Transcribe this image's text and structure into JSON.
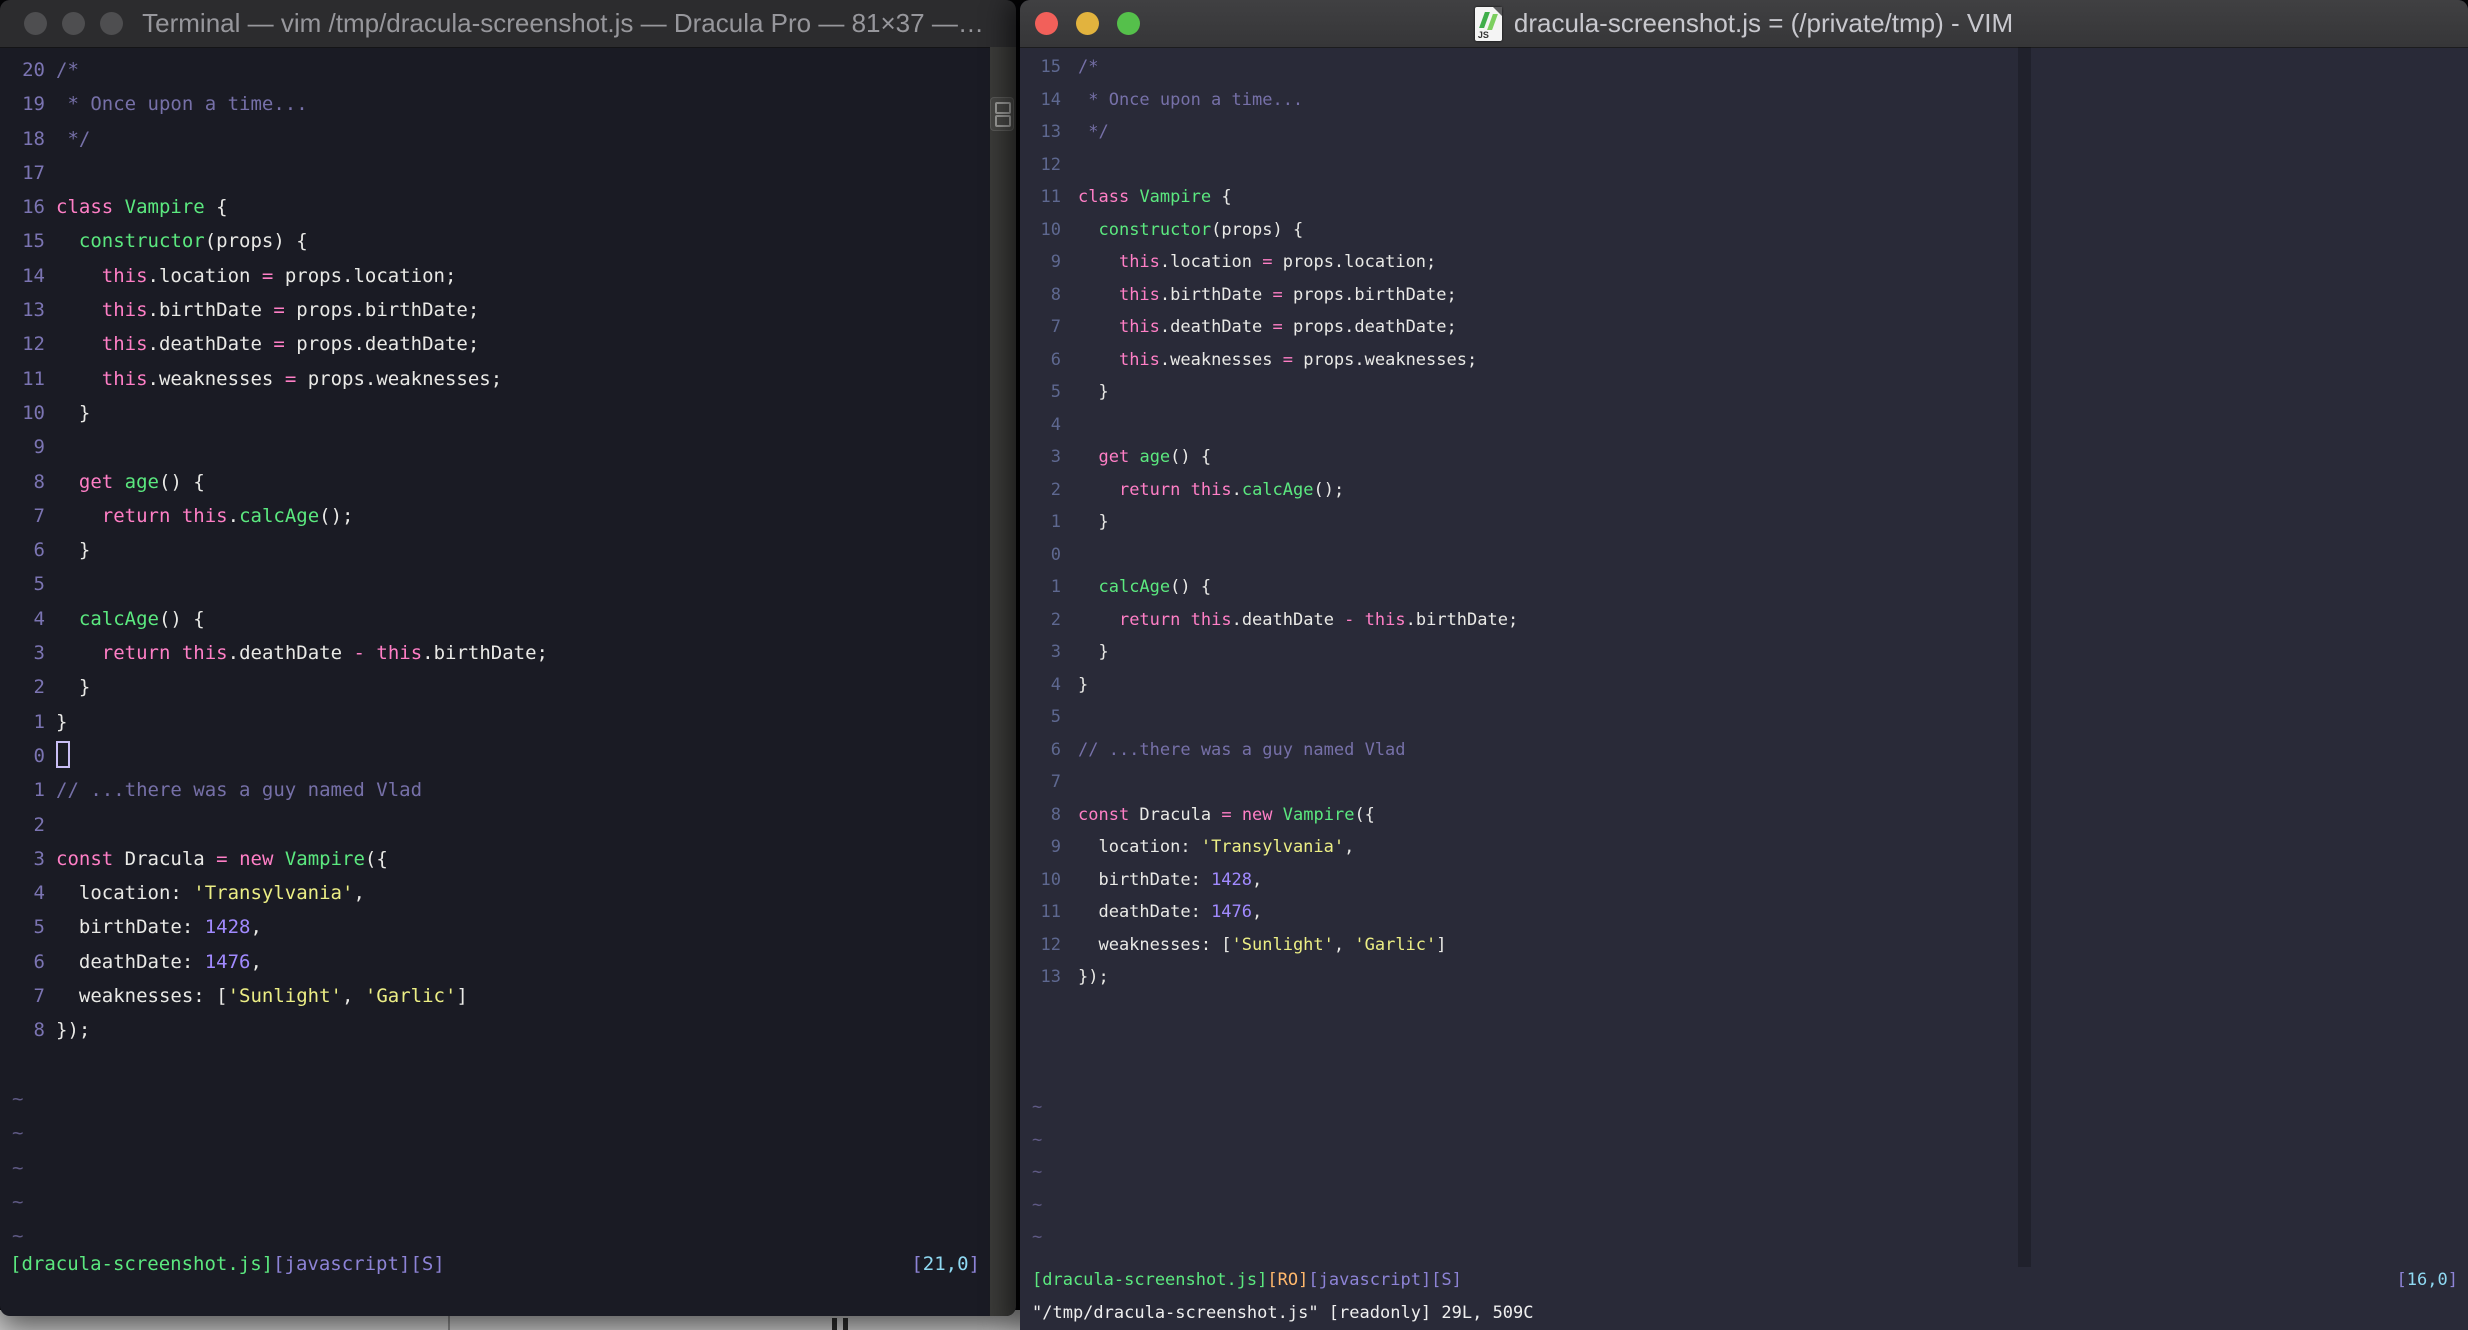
{
  "palette": {
    "cm": "#7670A8",
    "pk": "#FF7FC6",
    "gr": "#5BE87F",
    "fg": "#E9E9E6",
    "pu": "#A18AFF",
    "ye": "#ECEE85",
    "st": "#8D83D6",
    "cy": "#8FD9F2",
    "or": "#FFB86C",
    "fg2": "#EFEFEF",
    "lnL": "#7B74B2",
    "lnR": "#5E6890",
    "td": "#5F5A85",
    "left_bg": "#1A1B24",
    "right_bg": "#292A38"
  },
  "chrome": {
    "tilde": "~",
    "js_icon_label": "JS"
  },
  "buffer": {
    "lines": [
      [
        [
          "cm",
          "/*"
        ]
      ],
      [
        [
          "cm",
          " * Once upon a time..."
        ]
      ],
      [
        [
          "cm",
          " */"
        ]
      ],
      [],
      [
        [
          "pk",
          "class"
        ],
        [
          "fg",
          " "
        ],
        [
          "gr",
          "Vampire"
        ],
        [
          "fg",
          " {"
        ]
      ],
      [
        [
          "fg",
          "  "
        ],
        [
          "gr",
          "constructor"
        ],
        [
          "fg",
          "(props) {"
        ]
      ],
      [
        [
          "fg",
          "    "
        ],
        [
          "pk",
          "this"
        ],
        [
          "fg",
          ".location "
        ],
        [
          "pk",
          "="
        ],
        [
          "fg",
          " props.location;"
        ]
      ],
      [
        [
          "fg",
          "    "
        ],
        [
          "pk",
          "this"
        ],
        [
          "fg",
          ".birthDate "
        ],
        [
          "pk",
          "="
        ],
        [
          "fg",
          " props.birthDate;"
        ]
      ],
      [
        [
          "fg",
          "    "
        ],
        [
          "pk",
          "this"
        ],
        [
          "fg",
          ".deathDate "
        ],
        [
          "pk",
          "="
        ],
        [
          "fg",
          " props.deathDate;"
        ]
      ],
      [
        [
          "fg",
          "    "
        ],
        [
          "pk",
          "this"
        ],
        [
          "fg",
          ".weaknesses "
        ],
        [
          "pk",
          "="
        ],
        [
          "fg",
          " props.weaknesses;"
        ]
      ],
      [
        [
          "fg",
          "  }"
        ]
      ],
      [],
      [
        [
          "fg",
          "  "
        ],
        [
          "pk",
          "get"
        ],
        [
          "fg",
          " "
        ],
        [
          "gr",
          "age"
        ],
        [
          "fg",
          "() {"
        ]
      ],
      [
        [
          "fg",
          "    "
        ],
        [
          "pk",
          "return"
        ],
        [
          "fg",
          " "
        ],
        [
          "pk",
          "this"
        ],
        [
          "fg",
          "."
        ],
        [
          "gr",
          "calcAge"
        ],
        [
          "fg",
          "();"
        ]
      ],
      [
        [
          "fg",
          "  }"
        ]
      ],
      [],
      [
        [
          "fg",
          "  "
        ],
        [
          "gr",
          "calcAge"
        ],
        [
          "fg",
          "() {"
        ]
      ],
      [
        [
          "fg",
          "    "
        ],
        [
          "pk",
          "return"
        ],
        [
          "fg",
          " "
        ],
        [
          "pk",
          "this"
        ],
        [
          "fg",
          ".deathDate "
        ],
        [
          "pk",
          "-"
        ],
        [
          "fg",
          " "
        ],
        [
          "pk",
          "this"
        ],
        [
          "fg",
          ".birthDate;"
        ]
      ],
      [
        [
          "fg",
          "  }"
        ]
      ],
      [
        [
          "fg",
          "}"
        ]
      ],
      [],
      [
        [
          "cm",
          "// ...there was a guy named Vlad"
        ]
      ],
      [],
      [
        [
          "pk",
          "const"
        ],
        [
          "fg",
          " Dracula "
        ],
        [
          "pk",
          "="
        ],
        [
          "fg",
          " "
        ],
        [
          "pk",
          "new"
        ],
        [
          "fg",
          " "
        ],
        [
          "gr",
          "Vampire"
        ],
        [
          "fg",
          "({"
        ]
      ],
      [
        [
          "fg",
          "  location: "
        ],
        [
          "ye",
          "'Transylvania'"
        ],
        [
          "fg",
          ","
        ]
      ],
      [
        [
          "fg",
          "  birthDate: "
        ],
        [
          "pu",
          "1428"
        ],
        [
          "fg",
          ","
        ]
      ],
      [
        [
          "fg",
          "  deathDate: "
        ],
        [
          "pu",
          "1476"
        ],
        [
          "fg",
          ","
        ]
      ],
      [
        [
          "fg",
          "  weaknesses: ["
        ],
        [
          "ye",
          "'Sunlight'"
        ],
        [
          "fg",
          ", "
        ],
        [
          "ye",
          "'Garlic'"
        ],
        [
          "fg",
          "]"
        ]
      ],
      [
        [
          "fg",
          "});"
        ]
      ]
    ]
  },
  "left_window": {
    "title": "Terminal — vim /tmp/dracula-screenshot.js — Dracula Pro — 81×37 —…",
    "numbers": [
      "20",
      "19",
      "18",
      "17",
      "16",
      "15",
      "14",
      "13",
      "12",
      "11",
      "10",
      "9",
      "8",
      "7",
      "6",
      "5",
      "4",
      "3",
      "2",
      "1",
      "0",
      "1",
      "2",
      "3",
      "4",
      "5",
      "6",
      "7",
      "8"
    ],
    "cursor_index": 20,
    "show_cursor": true,
    "number_color_key": "lnL",
    "blank_rows": 1,
    "tilde_rows": 5,
    "status": [
      [
        "gr",
        "[dracula-screenshot.js]"
      ],
      [
        "st",
        "[javascript][S]"
      ]
    ],
    "ruler": [
      [
        "st",
        "["
      ],
      [
        "cy",
        "21,0"
      ],
      [
        "st",
        "]"
      ]
    ]
  },
  "right_window": {
    "title": "dracula-screenshot.js = (/private/tmp) - VIM",
    "numbers": [
      "15",
      "14",
      "13",
      "12",
      "11",
      "10",
      "9",
      "8",
      "7",
      "6",
      "5",
      "4",
      "3",
      "2",
      "1",
      "0",
      "1",
      "2",
      "3",
      "4",
      "5",
      "6",
      "7",
      "8",
      "9",
      "10",
      "11",
      "12",
      "13"
    ],
    "cursor_index": 15,
    "show_cursor": false,
    "number_color_key": "lnR",
    "blank_rows": 3,
    "tilde_rows": 5,
    "status": [
      [
        "gr",
        "[dracula-screenshot.js]"
      ],
      [
        "or",
        "[RO]"
      ],
      [
        "st",
        "[javascript][S]"
      ]
    ],
    "ruler": [
      [
        "st",
        "["
      ],
      [
        "cy",
        "16,0"
      ],
      [
        "st",
        "]"
      ]
    ],
    "command": [
      [
        "fg2",
        "\"/tmp/dracula-screenshot.js\" [readonly] 29L, 509C"
      ]
    ]
  }
}
